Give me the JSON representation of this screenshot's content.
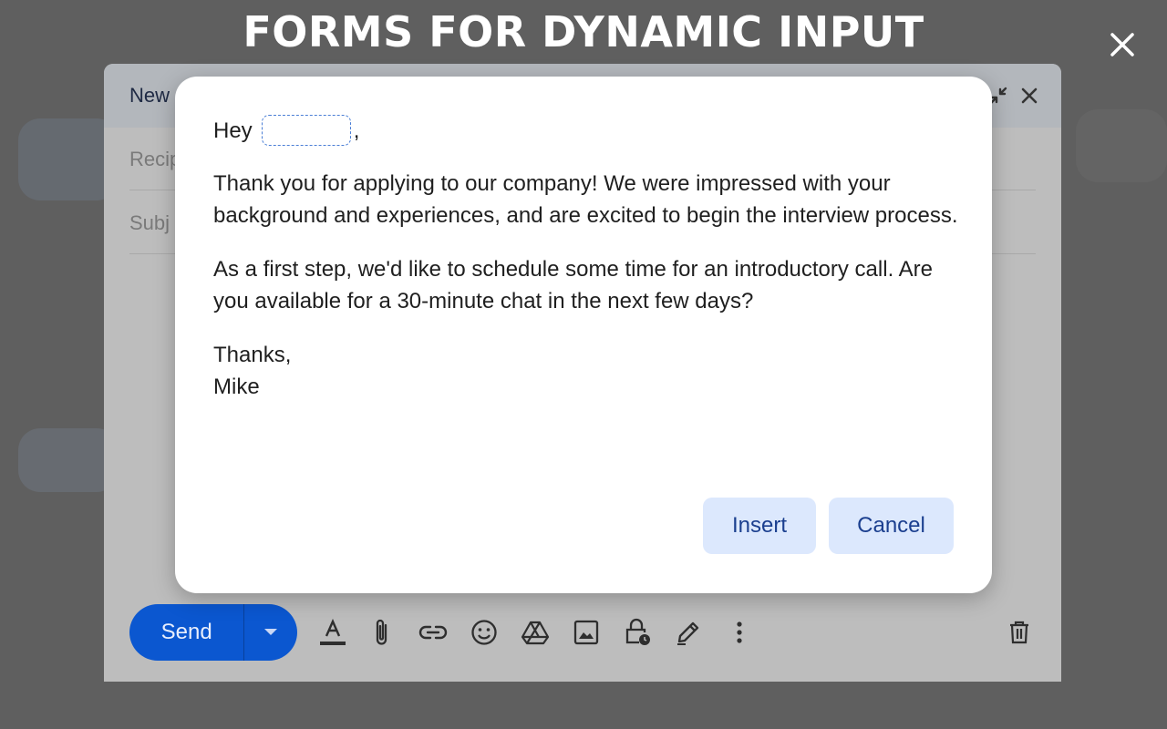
{
  "overlay": {
    "headline": "FORMS FOR DYNAMIC INPUT",
    "close_icon": "close-icon"
  },
  "compose": {
    "title": "New",
    "recipients_placeholder": "Recipients",
    "recipients_visible": "Recip",
    "subject_placeholder": "Subject",
    "subject_visible": "Subj",
    "send_label": "Send",
    "toolbar_icons": [
      "format-text-icon",
      "attach-icon",
      "link-icon",
      "emoji-icon",
      "drive-icon",
      "image-icon",
      "confidential-mode-icon",
      "signature-icon",
      "more-options-icon",
      "delete-icon"
    ]
  },
  "modal": {
    "greeting_prefix": "Hey",
    "greeting_suffix": ",",
    "name_field_value": "",
    "paragraph_1": "Thank you for applying to our company! We were impressed with your background and experiences, and are excited to begin the interview process.",
    "paragraph_2": "As a first step, we'd like to schedule some time for an introductory call. Are you available for a 30-minute chat in the next few days?",
    "signoff": "Thanks,",
    "signature": "Mike",
    "insert_label": "Insert",
    "cancel_label": "Cancel"
  },
  "colors": {
    "primary": "#0b57d0",
    "button_bg": "#dce8fd",
    "button_text": "#1b3f8f"
  }
}
